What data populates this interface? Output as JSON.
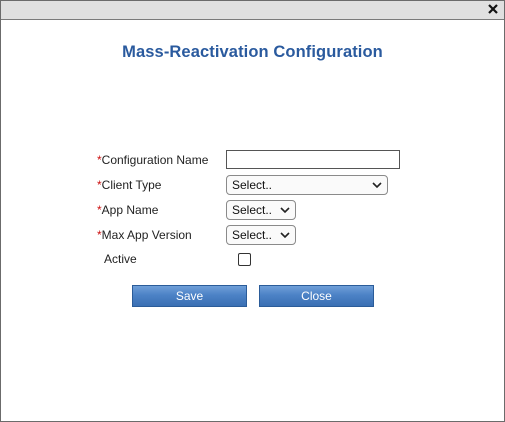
{
  "dialog": {
    "title": "Mass-Reactivation Configuration",
    "close_icon": "close-icon"
  },
  "form": {
    "required_marker": "*",
    "configuration_name": {
      "label": "Configuration Name",
      "value": ""
    },
    "client_type": {
      "label": "Client Type",
      "selected": "Select.."
    },
    "app_name": {
      "label": "App Name",
      "selected": "Select.."
    },
    "max_app_version": {
      "label": "Max App Version",
      "selected": "Select.."
    },
    "active": {
      "label": "Active",
      "checked": false
    }
  },
  "buttons": {
    "save_label": "Save",
    "close_label": "Close"
  },
  "colors": {
    "title": "#2a5a9e",
    "required": "#cc1111",
    "button_top": "#6f9fd8",
    "button_bottom": "#3a6fb3"
  }
}
